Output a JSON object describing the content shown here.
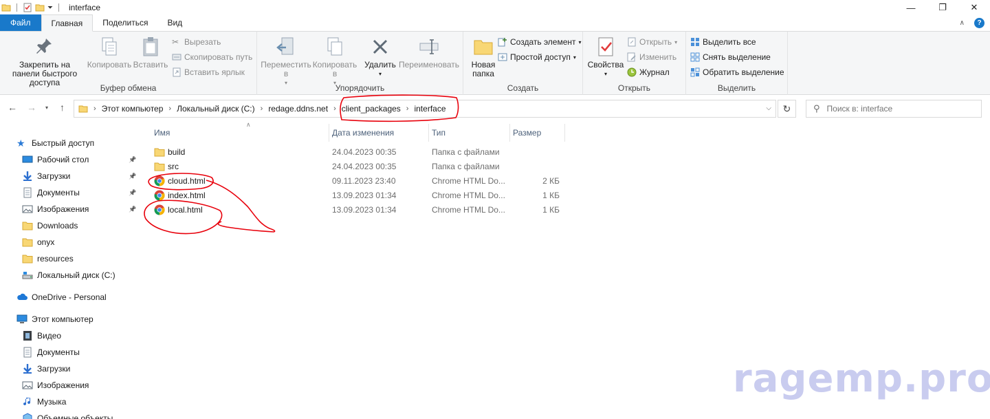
{
  "window": {
    "title": "interface",
    "controls": [
      "—",
      "❐",
      "✕"
    ]
  },
  "tabs": [
    {
      "label": "Файл"
    },
    {
      "label": "Главная"
    },
    {
      "label": "Поделиться"
    },
    {
      "label": "Вид"
    }
  ],
  "ribbon": {
    "clipboard": {
      "label": "Буфер обмена",
      "pin": "Закрепить на панели быстрого доступа",
      "copy": "Копировать",
      "paste": "Вставить",
      "cut": "Вырезать",
      "copy_path": "Скопировать путь",
      "paste_shortcut": "Вставить ярлык"
    },
    "organize": {
      "label": "Упорядочить",
      "move_to": "Переместить в",
      "copy_to": "Копировать в",
      "delete": "Удалить",
      "rename": "Переименовать"
    },
    "new": {
      "label": "Создать",
      "new_folder": "Новая папка",
      "new_item": "Создать элемент",
      "easy_access": "Простой доступ"
    },
    "open": {
      "label": "Открыть",
      "properties": "Свойства",
      "open": "Открыть",
      "edit": "Изменить",
      "history": "Журнал"
    },
    "select": {
      "label": "Выделить",
      "select_all": "Выделить все",
      "select_none": "Снять выделение",
      "invert": "Обратить выделение"
    }
  },
  "address": {
    "crumbs": [
      "Этот компьютер",
      "Локальный диск (C:)",
      "redage.ddns.net",
      "client_packages",
      "interface"
    ],
    "search_placeholder": "Поиск в: interface"
  },
  "nav": {
    "quick_access": "Быстрый доступ",
    "quick_items": [
      {
        "label": "Рабочий стол",
        "icon": "desktop-icon",
        "pinned": true
      },
      {
        "label": "Загрузки",
        "icon": "downloads-icon",
        "pinned": true
      },
      {
        "label": "Документы",
        "icon": "documents-icon",
        "pinned": true
      },
      {
        "label": "Изображения",
        "icon": "pictures-icon",
        "pinned": true
      },
      {
        "label": "Downloads",
        "icon": "folder-icon",
        "pinned": false
      },
      {
        "label": "onyx",
        "icon": "folder-icon",
        "pinned": false
      },
      {
        "label": "resources",
        "icon": "folder-icon",
        "pinned": false
      },
      {
        "label": "Локальный диск (C:)",
        "icon": "drive-icon",
        "pinned": false
      }
    ],
    "onedrive": "OneDrive - Personal",
    "this_pc": "Этот компьютер",
    "pc_items": [
      {
        "label": "Видео",
        "icon": "video-icon"
      },
      {
        "label": "Документы",
        "icon": "documents-icon"
      },
      {
        "label": "Загрузки",
        "icon": "downloads-icon"
      },
      {
        "label": "Изображения",
        "icon": "pictures-icon"
      },
      {
        "label": "Музыка",
        "icon": "music-icon"
      },
      {
        "label": "Объемные объекты",
        "icon": "3d-objects-icon"
      }
    ]
  },
  "columns": {
    "name": "Имя",
    "date": "Дата изменения",
    "type": "Тип",
    "size": "Размер"
  },
  "files": [
    {
      "name": "build",
      "date": "24.04.2023 00:35",
      "type": "Папка с файлами",
      "size": "",
      "kind": "folder"
    },
    {
      "name": "src",
      "date": "24.04.2023 00:35",
      "type": "Папка с файлами",
      "size": "",
      "kind": "folder"
    },
    {
      "name": "cloud.html",
      "date": "09.11.2023 23:40",
      "type": "Chrome HTML Do...",
      "size": "2 КБ",
      "kind": "chrome"
    },
    {
      "name": "index.html",
      "date": "13.09.2023 01:34",
      "type": "Chrome HTML Do...",
      "size": "1 КБ",
      "kind": "chrome"
    },
    {
      "name": "local.html",
      "date": "13.09.2023 01:34",
      "type": "Chrome HTML Do...",
      "size": "1 КБ",
      "kind": "chrome"
    }
  ],
  "watermark": "ragemp.pro",
  "colors": {
    "file_tab": "#1979ca",
    "folder": "#f8d775",
    "annotation": "#e8000b",
    "header_text": "#4c607a"
  }
}
